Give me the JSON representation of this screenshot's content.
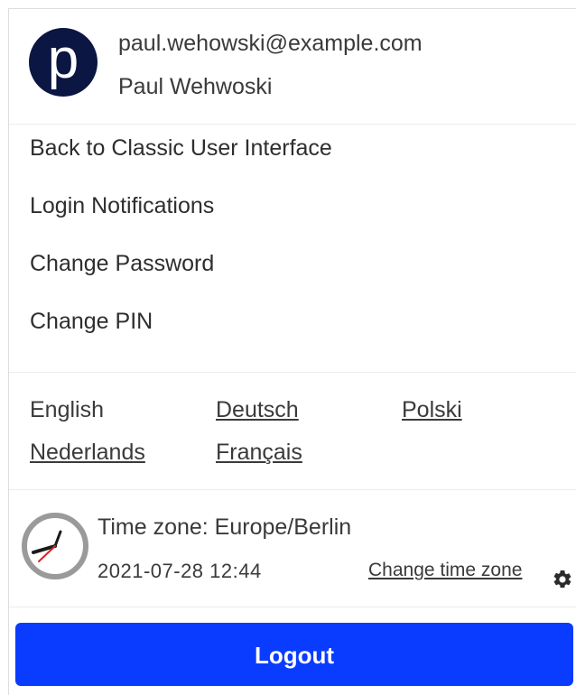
{
  "user": {
    "avatar_letter": "p",
    "email": "paul.wehowski@example.com",
    "name": "Paul Wehwoski"
  },
  "menu": {
    "items": [
      {
        "label": "Back to Classic User Interface"
      },
      {
        "label": "Login Notifications"
      },
      {
        "label": "Change Password"
      },
      {
        "label": "Change PIN"
      }
    ]
  },
  "languages": {
    "items": [
      {
        "label": "English",
        "active": true
      },
      {
        "label": "Deutsch",
        "active": false
      },
      {
        "label": "Polski",
        "active": false
      },
      {
        "label": "Nederlands",
        "active": false
      },
      {
        "label": "Français",
        "active": false
      }
    ]
  },
  "timezone": {
    "label": "Time zone: Europe/Berlin",
    "datetime": "2021-07-28 12:44",
    "change_label": "Change time zone",
    "clock_icon": "clock-icon",
    "gear_icon": "gear-icon"
  },
  "logout": {
    "label": "Logout"
  },
  "colors": {
    "avatar_bg": "#0b1642",
    "logout_bg": "#0a3cff",
    "clock_hand_red": "#e02020"
  }
}
